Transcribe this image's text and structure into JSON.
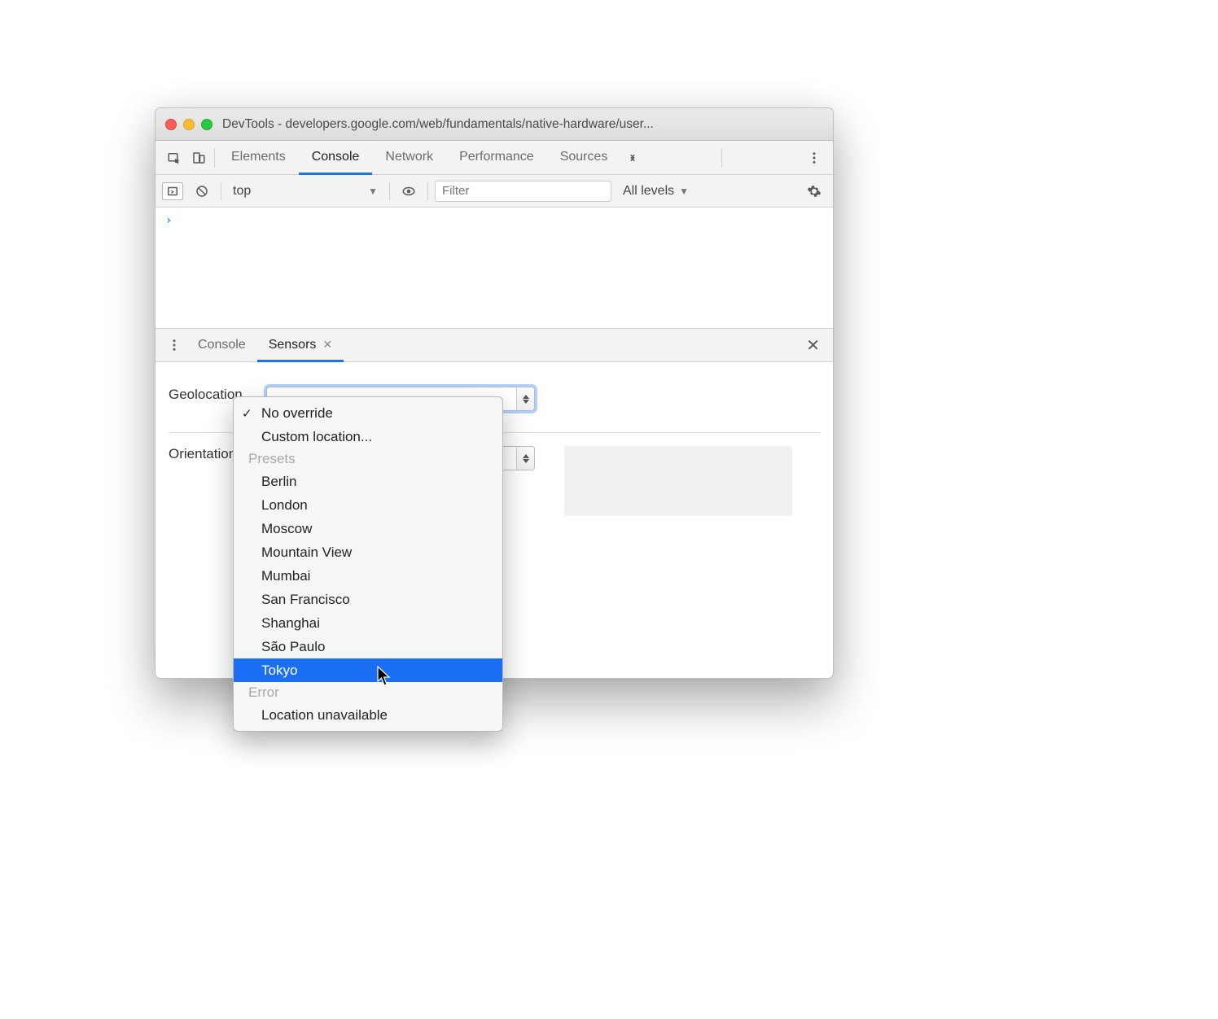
{
  "window": {
    "title": "DevTools - developers.google.com/web/fundamentals/native-hardware/user..."
  },
  "tabs": {
    "elements": "Elements",
    "console": "Console",
    "network": "Network",
    "performance": "Performance",
    "sources": "Sources",
    "active": "Console"
  },
  "console_toolbar": {
    "context": "top",
    "filter_placeholder": "Filter",
    "levels": "All levels"
  },
  "console_body": {
    "prompt": "›"
  },
  "drawer": {
    "tabs": {
      "console": "Console",
      "sensors": "Sensors"
    },
    "active": "Sensors"
  },
  "sensors": {
    "geolocation_label": "Geolocation",
    "orientation_label": "Orientation"
  },
  "geolocation_menu": {
    "no_override": "No override",
    "custom_location": "Custom location...",
    "presets_group": "Presets",
    "presets": [
      "Berlin",
      "London",
      "Moscow",
      "Mountain View",
      "Mumbai",
      "San Francisco",
      "Shanghai",
      "São Paulo",
      "Tokyo"
    ],
    "error_group": "Error",
    "error_items": [
      "Location unavailable"
    ],
    "selected": "No override",
    "highlighted": "Tokyo"
  }
}
